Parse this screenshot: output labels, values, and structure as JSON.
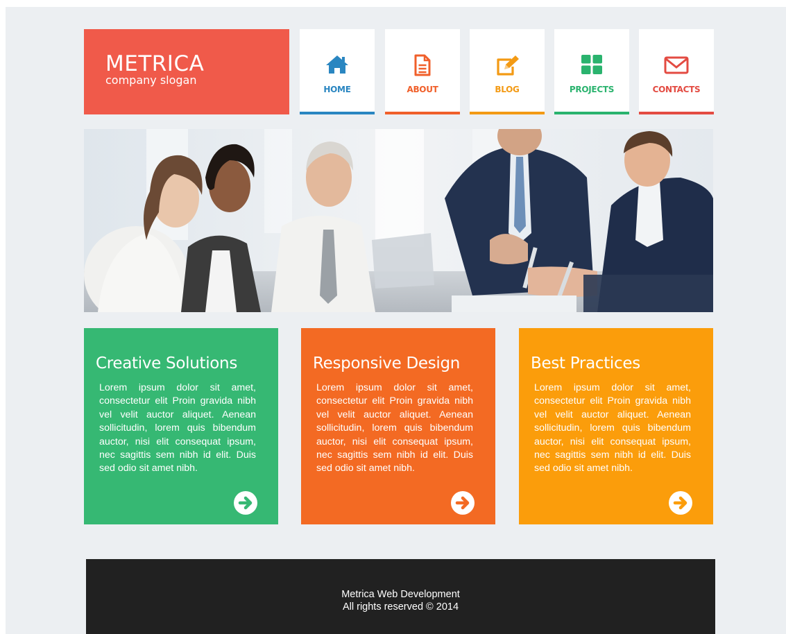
{
  "brand": {
    "name": "METRICA",
    "slogan": "company slogan",
    "color": "#f05a4a"
  },
  "nav": [
    {
      "label": "HOME",
      "icon": "home-icon",
      "color": "#2a86c1"
    },
    {
      "label": "ABOUT",
      "icon": "document-icon",
      "color": "#f05f2a"
    },
    {
      "label": "BLOG",
      "icon": "edit-icon",
      "color": "#f39a14"
    },
    {
      "label": "PROJECTS",
      "icon": "grid-icon",
      "color": "#2ab36e"
    },
    {
      "label": "CONTACTS",
      "icon": "envelope-icon",
      "color": "#e34b42"
    }
  ],
  "hero": {
    "image": "business-team-photo"
  },
  "features": [
    {
      "title": "Creative Solutions",
      "text": "Lorem ipsum dolor sit amet, consectetur elit Proin gravida nibh vel velit auctor aliquet. Aenean sollicitudin, lorem quis bibendum auctor, nisi elit consequat ipsum, nec sagittis sem nibh id elit. Duis sed odio sit amet nibh.",
      "color": "#36b873"
    },
    {
      "title": "Responsive Design",
      "text": "Lorem ipsum dolor sit amet, consectetur elit Proin gravida nibh vel velit auctor aliquet. Aenean sollicitudin, lorem quis bibendum auctor, nisi elit consequat ipsum, nec sagittis sem nibh id elit. Duis sed odio sit amet nibh.",
      "color": "#f36a23"
    },
    {
      "title": "Best Practices",
      "text": "Lorem ipsum dolor sit amet, consectetur elit Proin gravida nibh vel velit auctor aliquet. Aenean sollicitudin, lorem quis bibendum auctor, nisi elit consequat ipsum, nec sagittis sem nibh id elit. Duis sed odio sit amet nibh.",
      "color": "#fb9d0b"
    }
  ],
  "footer": {
    "line1": "Metrica Web Development",
    "line2": "All rights reserved © 2014"
  }
}
